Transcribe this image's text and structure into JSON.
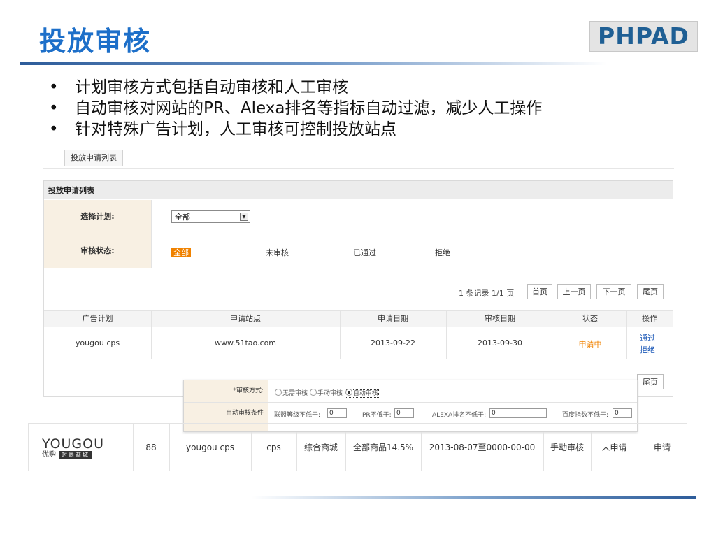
{
  "slide": {
    "title": "投放审核",
    "logo": "PHPAD",
    "bullets": [
      "计划审核方式包括自动审核和人工审核",
      "自动审核对网站的PR、Alexa排名等指标自动过滤，减少人工操作",
      "针对特殊广告计划，人工审核可控制投放站点"
    ]
  },
  "panel": {
    "tab": "投放申请列表",
    "list_title": "投放申请列表",
    "plan_label": "选择计划:",
    "plan_select": "全部",
    "status_label": "审核状态:",
    "status_options": [
      "全部",
      "未审核",
      "已通过",
      "拒绝"
    ],
    "pager": {
      "summary": "1 条记录 1/1 页",
      "first": "首页",
      "prev": "上一页",
      "next": "下一页",
      "last": "尾页"
    },
    "columns": [
      "广告计划",
      "申请站点",
      "申请日期",
      "审核日期",
      "状态",
      "操作"
    ],
    "rows": [
      {
        "plan": "yougou cps",
        "site": "www.51tao.com",
        "apply_date": "2013-09-22",
        "review_date": "2013-09-30",
        "status": "申请中",
        "action_pass": "通过",
        "action_reject": "拒绝"
      }
    ],
    "pager_bottom_last": "尾页"
  },
  "overlay": {
    "mode_label": "*审核方式:",
    "modes": [
      "无需审核",
      "手动审核",
      "自动审核"
    ],
    "selected_mode": "自动审核",
    "cond_label": "自动审核条件",
    "union_level_label": "联盟等级不低于:",
    "union_level_value": "0",
    "pr_label": "PR不低于:",
    "pr_value": "0",
    "alexa_label": "ALEXA排名不低于:",
    "alexa_value": "0",
    "baidu_label": "百度指数不低于:",
    "baidu_value": "0"
  },
  "product": {
    "brand_top": "YOUGOU",
    "brand_cn": "优购",
    "brand_tag": "时尚商城",
    "id": "88",
    "plan": "yougou cps",
    "type": "cps",
    "category": "综合商城",
    "commission": "全部商品14.5%",
    "period": "2013-08-07至0000-00-00",
    "review": "手动审核",
    "state": "未申请",
    "action": "申请"
  }
}
